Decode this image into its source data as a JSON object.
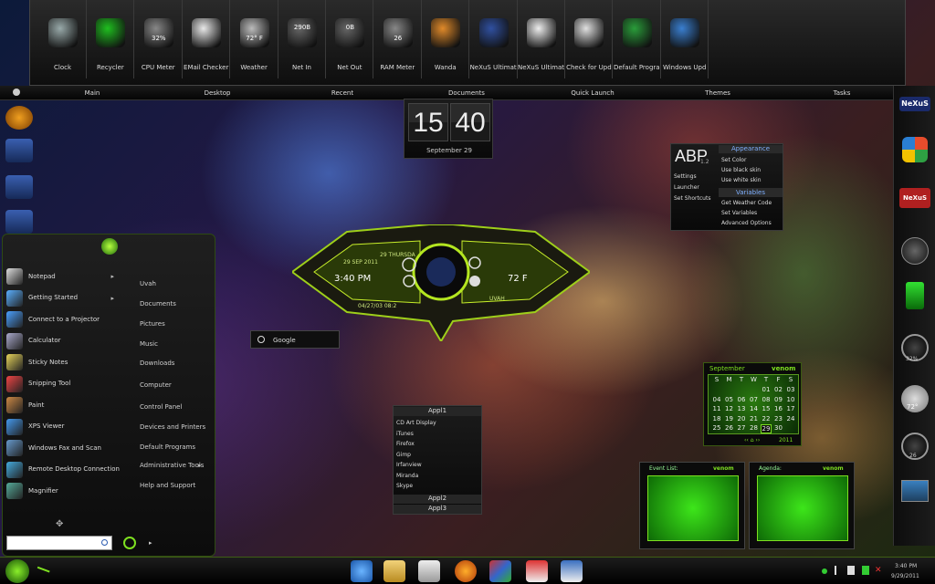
{
  "dock": {
    "items": [
      {
        "label": "Clock",
        "icon": "clock-icon",
        "color": "#9aa"
      },
      {
        "label": "Recycler",
        "icon": "recycle-bin-icon",
        "color": "#1fbf1f"
      },
      {
        "label": "CPU Meter",
        "icon": "gauge-icon",
        "color": "#888"
      },
      {
        "label": "EMail Checker",
        "icon": "envelope-icon",
        "color": "#e8e8e8"
      },
      {
        "label": "Weather",
        "icon": "cloud-icon",
        "color": "#bbb"
      },
      {
        "label": "Net In",
        "icon": "counter-icon",
        "color": "#666"
      },
      {
        "label": "Net Out",
        "icon": "counter-icon",
        "color": "#666"
      },
      {
        "label": "RAM Meter",
        "icon": "gauge-icon",
        "color": "#888"
      },
      {
        "label": "Wanda",
        "icon": "fish-icon",
        "color": "#e08a2a"
      },
      {
        "label": "NeXuS Ultimat",
        "icon": "nexus-icon",
        "color": "#3050a0"
      },
      {
        "label": "NeXuS Ultimat",
        "icon": "info-icon",
        "color": "#eee"
      },
      {
        "label": "Check for Upd",
        "icon": "update-icon",
        "color": "#e0e0e0"
      },
      {
        "label": "Default Progra",
        "icon": "windows-logo-icon",
        "color": "#2a9d3a"
      },
      {
        "label": "Windows Upd",
        "icon": "windows-update-icon",
        "color": "#3a7fd0"
      }
    ],
    "readouts": {
      "weather": "72° F",
      "netin": "290B",
      "netout": "0B",
      "cpu": "32%",
      "ram": "26"
    }
  },
  "menubar": {
    "items": [
      "Main",
      "Desktop",
      "Recent",
      "Documents",
      "Quick Launch",
      "Themes",
      "Tasks"
    ]
  },
  "clock": {
    "hour": "15",
    "minute": "40",
    "date": "September 29"
  },
  "abp": {
    "logo": "ABP",
    "version": "1.2",
    "left": [
      "Settings",
      "Launcher",
      "Set Shortcuts"
    ],
    "appearance_title": "Appearance",
    "appearance": [
      "Set Color",
      "Use black skin",
      "Use white skin"
    ],
    "variables_title": "Variables",
    "variables": [
      "Get Weather Code",
      "Set Variables",
      "Advanced Options"
    ]
  },
  "hud": {
    "day": "29 THURSDA",
    "date": "29 SEP 2011",
    "time": "3:40 PM",
    "temp": "72 F",
    "drive": "UVAH",
    "stamp": "04/27/03 08:2"
  },
  "search": {
    "value": "Google"
  },
  "apps": {
    "group1": "Appl1",
    "items": [
      "CD Art Display",
      "iTunes",
      "Firefox",
      "Gimp",
      "Irfanview",
      "Miranda",
      "Skype"
    ],
    "group2": "Appl2",
    "group3": "Appl3"
  },
  "calendar": {
    "month": "September",
    "brand": "venom",
    "year": "2011",
    "headers": [
      "S",
      "M",
      "T",
      "W",
      "T",
      "F",
      "S"
    ],
    "days": [
      "",
      "",
      "",
      "",
      "01",
      "02",
      "03",
      "04",
      "05",
      "06",
      "07",
      "08",
      "09",
      "10",
      "11",
      "12",
      "13",
      "14",
      "15",
      "16",
      "17",
      "18",
      "19",
      "20",
      "21",
      "22",
      "23",
      "24",
      "25",
      "26",
      "27",
      "28",
      "29",
      "30",
      ""
    ],
    "today": "29"
  },
  "events": {
    "title": "Event List:",
    "brand": "venom"
  },
  "agenda": {
    "title": "Agenda:",
    "brand": "venom"
  },
  "startmenu": {
    "left": [
      {
        "label": "Notepad",
        "arrow": true
      },
      {
        "label": "Getting Started",
        "arrow": true
      },
      {
        "label": "Connect to a Projector",
        "arrow": false
      },
      {
        "label": "Calculator",
        "arrow": false
      },
      {
        "label": "Sticky Notes",
        "arrow": false
      },
      {
        "label": "Snipping Tool",
        "arrow": false
      },
      {
        "label": "Paint",
        "arrow": false
      },
      {
        "label": "XPS Viewer",
        "arrow": false
      },
      {
        "label": "Windows Fax and Scan",
        "arrow": false
      },
      {
        "label": "Remote Desktop Connection",
        "arrow": false
      },
      {
        "label": "Magnifier",
        "arrow": false
      }
    ],
    "right": [
      "Uvah",
      "Documents",
      "Pictures",
      "Music",
      "Downloads",
      "Computer",
      "Control Panel",
      "Devices and Printers",
      "Default Programs",
      "Administrative Tools",
      "Help and Support"
    ],
    "search_value": ""
  },
  "tray": {
    "time": "3:40 PM",
    "date": "9/29/2011"
  },
  "rightbar": {
    "temp": "72°",
    "cpu": "32%",
    "ram": "26"
  }
}
